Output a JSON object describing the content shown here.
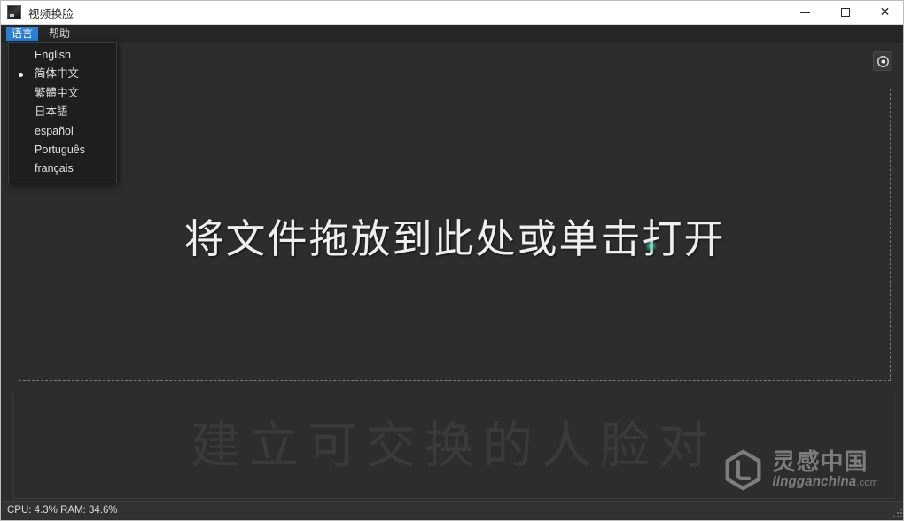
{
  "window": {
    "title": "视频换脸",
    "app_icon": "app-icon",
    "controls": {
      "minimize": "minimize-icon",
      "maximize": "maximize-icon",
      "close": "close-icon"
    }
  },
  "menubar": {
    "items": [
      {
        "label": "语言",
        "active": true
      },
      {
        "label": "帮助",
        "active": false
      }
    ]
  },
  "language_menu": {
    "open": true,
    "items": [
      {
        "label": "English",
        "selected": false
      },
      {
        "label": "简体中文",
        "selected": true
      },
      {
        "label": "繁體中文",
        "selected": false
      },
      {
        "label": "日本語",
        "selected": false
      },
      {
        "label": "español",
        "selected": false
      },
      {
        "label": "Português",
        "selected": false
      },
      {
        "label": "français",
        "selected": false
      }
    ]
  },
  "main": {
    "settings_icon": "gear-icon",
    "dropzone_text": "将文件拖放到此处或单击打开",
    "slogan": "建立可交换的人脸对"
  },
  "watermark": {
    "cn": "灵感中国",
    "en": "lingganchina",
    "domain": ".com"
  },
  "statusbar": {
    "text": "CPU: 4.3%  RAM: 34.6%",
    "cpu": "4.3%",
    "ram": "34.6%"
  },
  "colors": {
    "titlebar_bg": "#ffffff",
    "menubar_bg": "#262626",
    "menu_highlight": "#2a7fd4",
    "content_bg": "#2d2d2d",
    "dropdown_bg": "#1e1e1e",
    "dashed_border": "#7a7a7a",
    "slogan_color": "#3a3a3a",
    "statusbar_bg": "#323232",
    "cursor_dot": "#63d8b4"
  }
}
